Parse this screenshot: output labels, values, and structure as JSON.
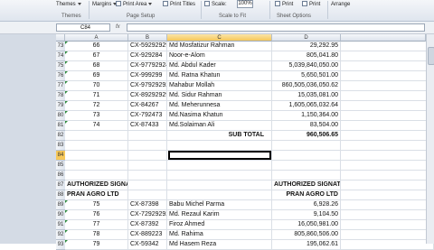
{
  "ribbon": {
    "themes_label": "Themes",
    "themes_group": "Themes",
    "margins_label": "Margins",
    "print_area_label": "Print Area",
    "print_titles_label": "Print Titles",
    "page_setup_group": "Page Setup",
    "scale_label": "Scale:",
    "scale_value": "100%",
    "scale_group": "Scale to Fit",
    "print_label_1": "Print",
    "print_label_2": "Print",
    "sheet_options_group": "Sheet Options",
    "arrange_label": "Arrange"
  },
  "formula_bar": {
    "name_box": "C84",
    "fx": "fx",
    "content": ""
  },
  "columns": [
    "A",
    "B",
    "C",
    "D"
  ],
  "rows": [
    {
      "num": "73",
      "a": "66",
      "b": "CX-592929292",
      "c": "Md Mosfatizur Rahman",
      "d": "29,292.95",
      "tri": true
    },
    {
      "num": "74",
      "a": "67",
      "b": "CX-929284",
      "c": "Noor-e-Alom",
      "d": "805,041.80",
      "tri": true
    },
    {
      "num": "75",
      "a": "68",
      "b": "CX-97792924",
      "c": "Md. Abdul Kader",
      "d": "5,039,840,050.00",
      "tri": true
    },
    {
      "num": "76",
      "a": "69",
      "b": "CX-999299",
      "c": "Md. Ratna Khatun",
      "d": "5,650,501.00",
      "tri": true
    },
    {
      "num": "77",
      "a": "70",
      "b": "CX-979292929292",
      "c": "Mahabur Mollah",
      "d": "860,505,036,050.62",
      "tri": true
    },
    {
      "num": "78",
      "a": "71",
      "b": "CX-892929292292",
      "c": "Md. Sidur Rahman",
      "d": "15,035,081.00",
      "tri": true
    },
    {
      "num": "79",
      "a": "72",
      "b": "CX-84267",
      "c": "Md. Meherunnesa",
      "d": "1,605,065,032.64",
      "tri": true
    },
    {
      "num": "80",
      "a": "73",
      "b": "CX-792473",
      "c": "Md.Nasima Khatun",
      "d": "1,150,364.00",
      "tri": true
    },
    {
      "num": "81",
      "a": "74",
      "b": "CX-87433",
      "c": "Md.Solaiman Ali",
      "d": "83,504.00",
      "tri": true
    },
    {
      "num": "82",
      "a": "",
      "b": "",
      "c": "SUB TOTAL",
      "d": "960,506.65",
      "bold": true
    },
    {
      "num": "83",
      "a": "",
      "b": "",
      "c": "",
      "d": ""
    },
    {
      "num": "84",
      "a": "",
      "b": "",
      "c": "",
      "d": "",
      "selected": true
    },
    {
      "num": "85",
      "a": "",
      "b": "",
      "c": "",
      "d": ""
    },
    {
      "num": "86",
      "a": "",
      "b": "",
      "c": "",
      "d": ""
    },
    {
      "num": "87",
      "a": "AUTHORIZED SIGNATURE",
      "b": "",
      "c": "",
      "d": "AUTHORIZED SIGNATURE",
      "bold": true
    },
    {
      "num": "88",
      "a": "PRAN AGRO LTD",
      "b": "",
      "c": "",
      "d": "PRAN AGRO LTD",
      "bold": true
    },
    {
      "num": "89",
      "a": "75",
      "b": "CX-87398",
      "c": "Babu Michel Parma",
      "d": "6,928.26",
      "tri": true
    },
    {
      "num": "90",
      "a": "76",
      "b": "CX-7292929292",
      "c": "Md. Rezaul Karim",
      "d": "9,104.50",
      "tri": true
    },
    {
      "num": "91",
      "a": "77",
      "b": "CX-87392",
      "c": "Firoz Ahmed",
      "d": "16,050,981.00",
      "tri": true
    },
    {
      "num": "92",
      "a": "78",
      "b": "CX-889223",
      "c": "Md. Rahima",
      "d": "805,860,506.00",
      "tri": true
    },
    {
      "num": "93",
      "a": "79",
      "b": "CX-59342",
      "c": "Md Hasem Reza",
      "d": "195,062.61",
      "tri": true
    }
  ]
}
